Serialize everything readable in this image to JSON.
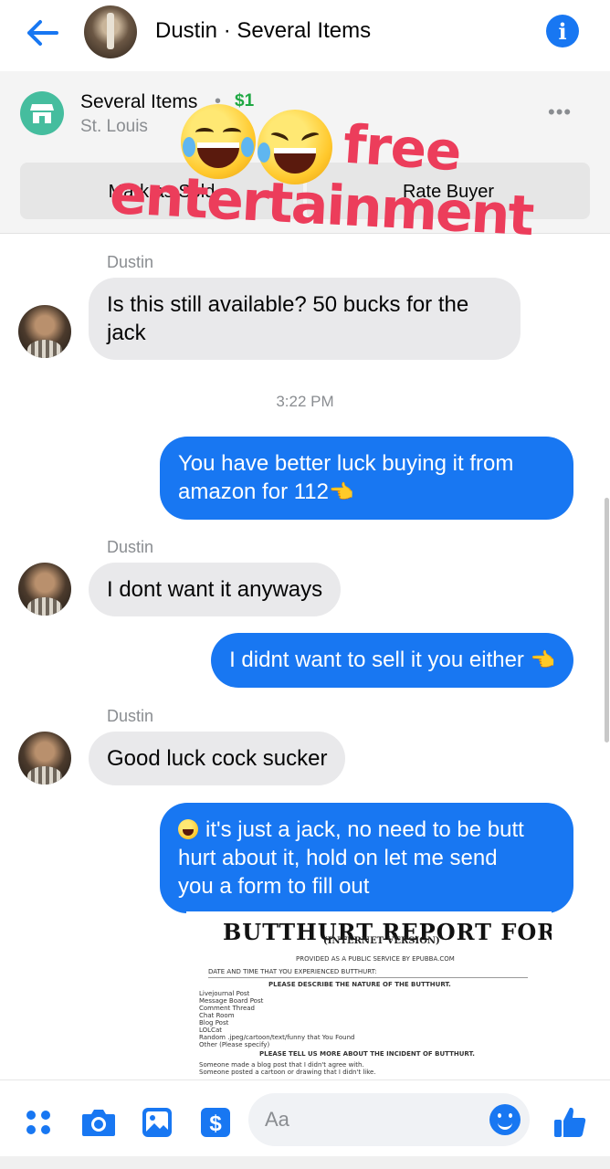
{
  "header": {
    "title": "Dustin · Several Items"
  },
  "listing": {
    "name": "Several Items",
    "separator": "•",
    "price": "$1",
    "location": "St. Louis",
    "more": "•••",
    "mark_sold_label": "Mark as Sold",
    "rate_buyer_label": "Rate Buyer"
  },
  "sticker": {
    "line1": "free",
    "line2": "entertainment"
  },
  "messages": [
    {
      "from": "Dustin",
      "sender_label": "Dustin",
      "text_lines": [
        "Is this still available? 50 bucks for the",
        "jack"
      ]
    },
    {
      "timestamp": "3:22 PM"
    },
    {
      "from": "me",
      "text_lines": [
        "You have better luck buying it from",
        "amazon for 112"
      ],
      "trailing_emoji": "👈"
    },
    {
      "from": "Dustin",
      "sender_label": "Dustin",
      "text": "I dont want it anyways"
    },
    {
      "from": "me",
      "text": "I didnt want to sell it you either ",
      "trailing_emoji": "👈"
    },
    {
      "from": "Dustin",
      "sender_label": "Dustin",
      "text": "Good luck cock sucker"
    },
    {
      "from": "me",
      "text_lines": [
        "it's just a jack, no need to be butt",
        "hurt about it, hold on let me send",
        "you a form to fill out"
      ]
    }
  ],
  "form_image": {
    "title": "BUTTHURT REPORT FORM",
    "subtitle": "(INTERNET VERSION)",
    "provided": "PROVIDED AS A PUBLIC SERVICE BY EPUBBA.COM",
    "date_line": "DATE AND TIME THAT YOU EXPERIENCED BUTTHURT:",
    "describe": "PLEASE DESCRIBE THE NATURE OF THE BUTTHURT.",
    "options": [
      "Livejournal Post",
      "Message Board Post",
      "Comment Thread",
      "Chat Room",
      "Blog Post",
      "LOLCat",
      "Random .jpeg/cartoon/text/funny that You Found",
      "Other (Please specify)"
    ],
    "tell_more": "PLEASE TELL US MORE ABOUT THE INCIDENT OF BUTTHURT.",
    "incident_1": "Someone made a blog post that I didn't agree with.",
    "incident_2": "Someone posted a cartoon or drawing that I didn't like."
  },
  "composer": {
    "placeholder": "Aa"
  },
  "colors": {
    "accent": "#1877f2",
    "incoming_bubble": "#e9e9eb",
    "price": "#1fa843",
    "shop_icon": "#45bd9e",
    "sticker_text": "#ec3d5b"
  },
  "icons": [
    "back-arrow-icon",
    "info-icon",
    "shop-icon",
    "more-icon",
    "apps-icon",
    "camera-icon",
    "gallery-icon",
    "payment-icon",
    "emoji-icon",
    "thumbs-up-icon"
  ]
}
